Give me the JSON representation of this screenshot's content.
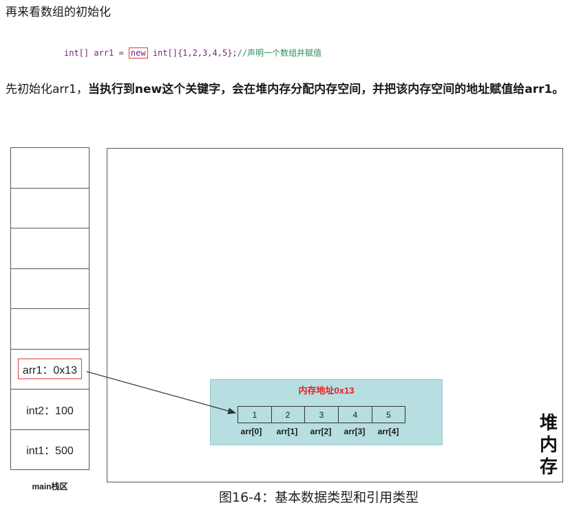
{
  "heading": "再来看数组的初始化",
  "code": {
    "part1": "int[] arr1 = ",
    "new_kw": "new",
    "part2": " int[]{1,2,3,4,5};",
    "comment": "//声明一个数组并赋值"
  },
  "paragraph": {
    "plain": "先初始化arr1，",
    "bold": "当执行到new这个关键字，会在堆内存分配内存空间，并把该内存空间的地址赋值给arr1。"
  },
  "stack": {
    "cells": [
      "",
      "",
      "",
      "",
      "",
      "arr1：0x13",
      "int2：100",
      "int1：500"
    ],
    "label": "main栈区"
  },
  "heap": {
    "label": "堆内存",
    "block_title": "内存地址0x13",
    "elements": [
      "1",
      "2",
      "3",
      "4",
      "5"
    ],
    "indices": [
      "arr[0]",
      "arr[1]",
      "arr[2]",
      "arr[3]",
      "arr[4]"
    ]
  },
  "caption": "图16-4：基本数据类型和引用类型",
  "colors": {
    "highlight_red": "#e23a3a",
    "memory_block": "#b7dee1",
    "comment_green": "#2e8b57",
    "keyword_purple": "#7b1d7b"
  }
}
